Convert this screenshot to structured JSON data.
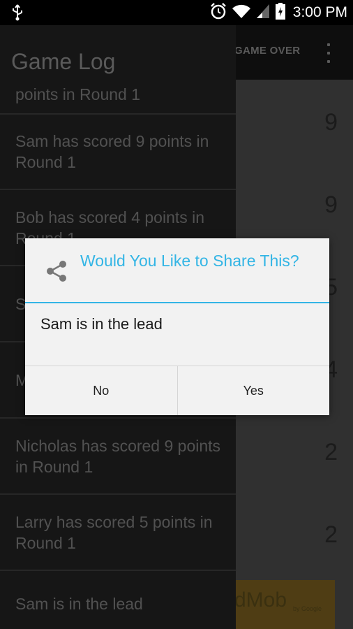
{
  "status_bar": {
    "time": "3:00 PM"
  },
  "main": {
    "action_label": "GAME OVER",
    "scores": [
      "9",
      "9",
      "5",
      "4",
      "2",
      "2"
    ],
    "ad_text": "dMob",
    "ad_small": "by Google"
  },
  "drawer": {
    "title": "Game Log",
    "items": [
      "points in Round 1",
      "Sam has scored 9 points in Round 1",
      "Bob has scored 4 points in Round 1",
      "S",
      "M",
      "Nicholas has scored 9 points in Round 1",
      "Larry has scored 5 points in Round 1",
      "Sam is in the lead"
    ]
  },
  "dialog": {
    "title": "Would You Like to Share This?",
    "message": "Sam is in the lead",
    "no_label": "No",
    "yes_label": "Yes"
  },
  "colors": {
    "accent": "#33b5e5",
    "drawer_bg": "#222222",
    "dialog_bg": "#f2f2f2"
  }
}
